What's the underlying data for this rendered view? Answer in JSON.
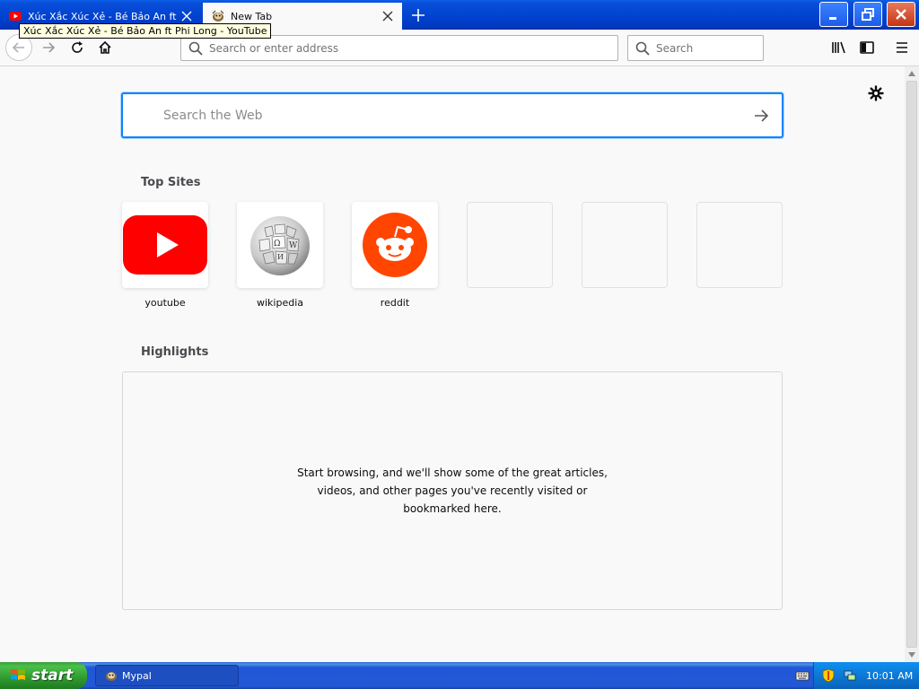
{
  "tabs": [
    {
      "label": "Xúc Xắc Xúc Xẻ - Bé Bảo An ft Phi Long - YouTube",
      "active": false,
      "favicon": "youtube-icon"
    },
    {
      "label": "New Tab",
      "active": true,
      "favicon": "mypal-icon"
    }
  ],
  "tooltip": "Xúc Xắc Xúc Xẻ - Bé Bảo An ft Phi Long - YouTube",
  "toolbar": {
    "url_placeholder": "Search or enter address",
    "search_placeholder": "Search"
  },
  "newtab": {
    "search_placeholder": "Search the Web",
    "top_sites_title": "Top Sites",
    "top_sites": [
      {
        "label": "youtube",
        "icon": "youtube-logo"
      },
      {
        "label": "wikipedia",
        "icon": "wikipedia-globe"
      },
      {
        "label": "reddit",
        "icon": "reddit-logo"
      },
      {
        "label": "",
        "icon": ""
      },
      {
        "label": "",
        "icon": ""
      },
      {
        "label": "",
        "icon": ""
      }
    ],
    "highlights_title": "Highlights",
    "highlights_empty": "Start browsing, and we'll show some of the great articles, videos, and other pages you've recently visited or bookmarked here."
  },
  "taskbar": {
    "start_label": "start",
    "task_label": "Mypal",
    "clock": "10:01 AM"
  },
  "colors": {
    "accent": "#0a84ff",
    "youtube_red": "#ff0000",
    "reddit_orange": "#ff4500",
    "xp_blue": "#2257d6",
    "xp_green": "#3c9b3c"
  }
}
